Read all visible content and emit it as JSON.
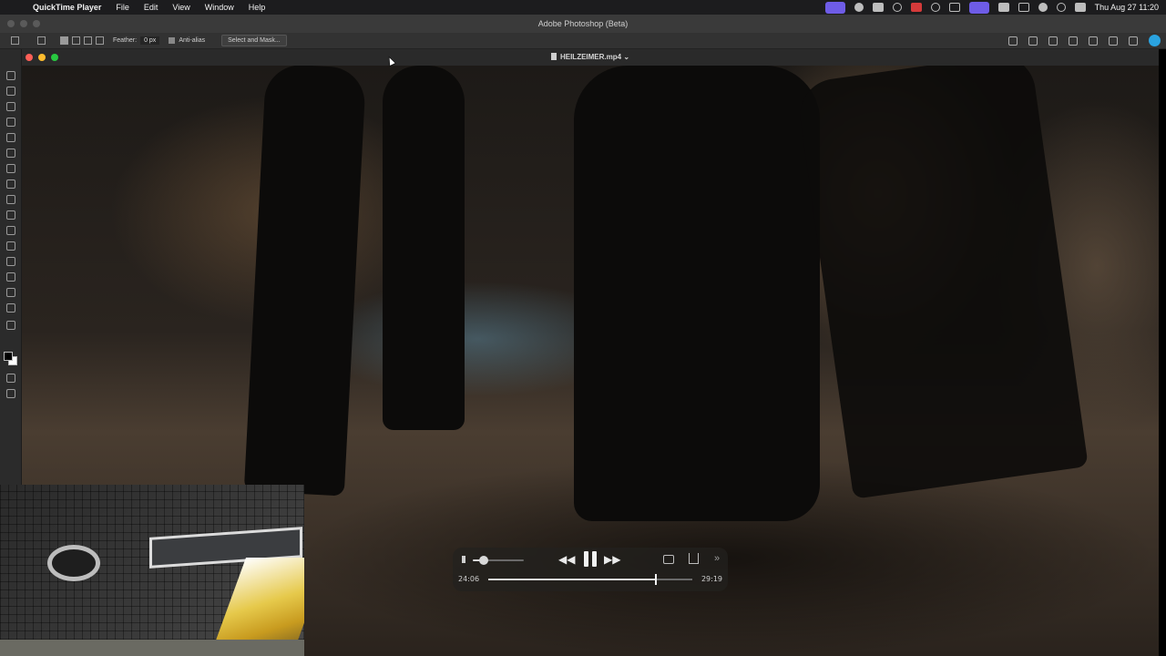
{
  "menubar": {
    "apple_icon": "apple-icon",
    "app_name": "QuickTime Player",
    "menus": [
      "File",
      "Edit",
      "View",
      "Window",
      "Help"
    ],
    "status_icons": [
      "screen-share-icon",
      "brightness-icon",
      "display-icon",
      "creative-cloud-icon",
      "app-icon",
      "play-icon",
      "stage-manager-icon",
      "window-icon",
      "oz-icon",
      "battery-icon",
      "wifi-icon",
      "search-icon",
      "control-center-icon"
    ],
    "datetime": "Thu Aug 27  11:20"
  },
  "photoshop": {
    "window_title": "Adobe Photoshop (Beta)",
    "options": {
      "feather_label": "Feather:",
      "feather_value": "0 px",
      "antialias_label": "Anti-alias",
      "antialias_checked": true,
      "select_mask_label": "Select and Mask..."
    }
  },
  "quicktime": {
    "file_name": "HEILZEIMER.mp4",
    "current_time": "24:06",
    "total_time": "29:19",
    "progress": 0.822,
    "volume": 0.22,
    "state": "playing"
  },
  "colors": {
    "accent_purple": "#6e5ce6",
    "close": "#ff5f57",
    "minimize": "#febc2e",
    "maximize": "#28c840"
  }
}
